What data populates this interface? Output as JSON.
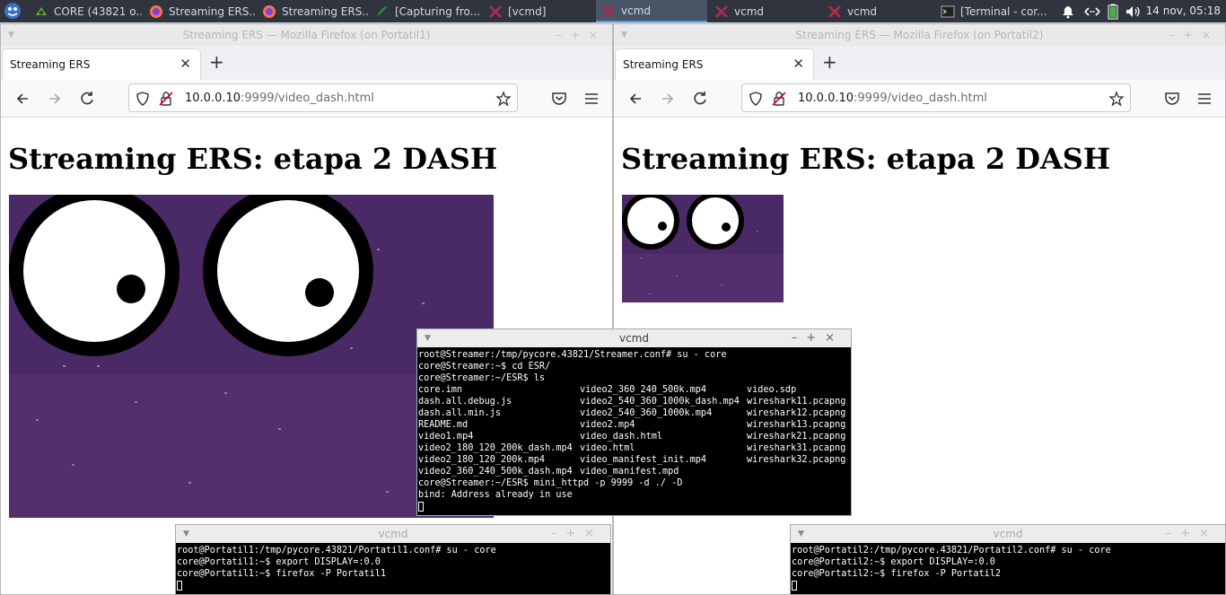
{
  "taskbar": {
    "items": [
      {
        "label": "CORE (43821 o...",
        "icon": "core-app-icon",
        "active": false
      },
      {
        "label": "Streaming ERS...",
        "icon": "firefox-icon",
        "active": false
      },
      {
        "label": "Streaming ERS...",
        "icon": "firefox-icon",
        "active": false
      },
      {
        "label": "[Capturing fro...",
        "icon": "wireshark-icon",
        "active": false
      },
      {
        "label": "[vcmd]",
        "icon": "xterm-icon",
        "active": false
      },
      {
        "label": "vcmd",
        "icon": "xterm-icon",
        "active": true
      },
      {
        "label": "vcmd",
        "icon": "xterm-icon",
        "active": false
      },
      {
        "label": "vcmd",
        "icon": "xterm-icon",
        "active": false
      },
      {
        "label": "[Terminal - cor...",
        "icon": "terminal-icon",
        "active": false
      }
    ],
    "clock": "14 nov, 05:18"
  },
  "browser_left": {
    "window_title": "Streaming ERS — Mozilla Firefox (on Portatil1)",
    "tab_label": "Streaming ERS",
    "url_host": "10.0.0.10",
    "url_rest": ":9999/video_dash.html",
    "page_heading": "Streaming ERS: etapa 2 DASH"
  },
  "browser_right": {
    "window_title": "Streaming ERS — Mozilla Firefox (on Portatil2)",
    "tab_label": "Streaming ERS",
    "url_host": "10.0.0.10",
    "url_rest": ":9999/video_dash.html",
    "page_heading": "Streaming ERS: etapa 2 DASH"
  },
  "term_streamer": {
    "title": "vcmd",
    "lines_top": [
      "root@Streamer:/tmp/pycore.43821/Streamer.conf# su - core",
      "core@Streamer:~$ cd ESR/",
      "core@Streamer:~/ESR$ ls"
    ],
    "ls_col1": [
      "core.imn",
      "dash.all.debug.js",
      "dash.all.min.js",
      "README.md",
      "video1.mp4",
      "video2_180_120_200k_dash.mp4",
      "video2_180_120_200k.mp4",
      "video2_360_240_500k_dash.mp4"
    ],
    "ls_col2": [
      "video2_360_240_500k.mp4",
      "video2_540_360_1000k_dash.mp4",
      "video2_540_360_1000k.mp4",
      "video2.mp4",
      "video_dash.html",
      "video.html",
      "video_manifest_init.mp4",
      "video_manifest.mpd"
    ],
    "ls_col3": [
      "video.sdp",
      "wireshark11.pcapng",
      "wireshark12.pcapng",
      "wireshark13.pcapng",
      "wireshark21.pcapng",
      "wireshark31.pcapng",
      "wireshark32.pcapng",
      ""
    ],
    "lines_bottom": [
      "core@Streamer:~/ESR$ mini_httpd -p 9999 -d ./ -D",
      "bind: Address already in use"
    ]
  },
  "term_portatil1": {
    "title": "vcmd",
    "lines": [
      "root@Portatil1:/tmp/pycore.43821/Portatil1.conf# su - core",
      "core@Portatil1:~$ export DISPLAY=:0.0",
      "core@Portatil1:~$ firefox -P Portatil1"
    ]
  },
  "term_portatil2": {
    "title": "vcmd",
    "lines": [
      "root@Portatil2:/tmp/pycore.43821/Portatil2.conf# su - core",
      "core@Portatil2:~$ export DISPLAY=:0.0",
      "core@Portatil2:~$ firefox -P Portatil2"
    ]
  },
  "colors": {
    "panel": "#2f343f",
    "video_purple": "#4a2a66",
    "terminal_bg": "#000000"
  }
}
